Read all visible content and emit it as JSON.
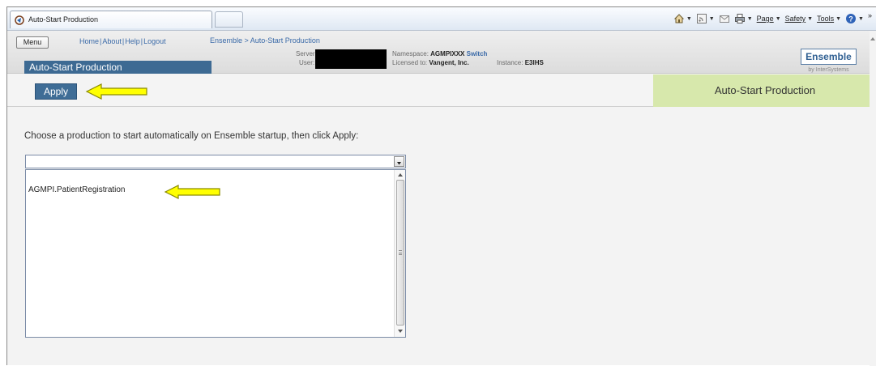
{
  "browser": {
    "tab_title": "Auto-Start Production",
    "commands": {
      "page": "Page",
      "safety": "Safety",
      "tools": "Tools",
      "more": "»"
    }
  },
  "header": {
    "menu_label": "Menu",
    "nav_links": [
      "Home",
      "About",
      "Help",
      "Logout"
    ],
    "breadcrumb": "Ensemble > Auto-Start Production",
    "title_tab": "Auto-Start Production",
    "server_label": "Server:",
    "user_label": "User:",
    "namespace_label": "Namespace:",
    "namespace_value": "AGMPIXXX",
    "switch_label": "Switch",
    "licensed_label": "Licensed to:",
    "licensed_value": "Vangent, Inc.",
    "instance_label": "Instance:",
    "instance_value": "E3IHS",
    "logo_text": "Ensemble",
    "logo_sub": "by InterSystems"
  },
  "toolbar": {
    "apply_label": "Apply",
    "page_title": "Auto-Start Production"
  },
  "main": {
    "instruction": "Choose a production to start automatically on Ensemble startup, then click Apply:",
    "combo_value": "",
    "productions": [
      "AGMPI.PatientRegistration"
    ]
  },
  "colors": {
    "accent_blue": "#3f6d96",
    "title_panel": "#d7e8ac",
    "highlight_arrow": "#ffff00"
  }
}
